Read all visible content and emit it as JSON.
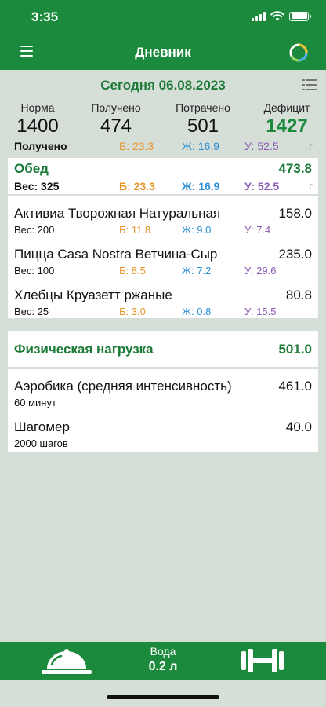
{
  "status": {
    "time": "3:35"
  },
  "nav": {
    "title": "Дневник",
    "menu_icon": "menu-icon",
    "stats_icon": "progress-ring-icon"
  },
  "summary": {
    "date": "Сегодня 06.08.2023",
    "columns": [
      {
        "label": "Норма",
        "value": "1400"
      },
      {
        "label": "Получено",
        "value": "474"
      },
      {
        "label": "Потрачено",
        "value": "501"
      },
      {
        "label": "Дефицит",
        "value": "1427"
      }
    ],
    "received_label": "Получено",
    "macros": {
      "b": "Б: 23.3",
      "j": "Ж: 16.9",
      "u": "У: 52.5",
      "unit": "г"
    }
  },
  "meal": {
    "title": "Обед",
    "total": "473.8",
    "weight": "Вес: 325",
    "b": "Б: 23.3",
    "j": "Ж: 16.9",
    "u": "У: 52.5",
    "unit": "г",
    "items": [
      {
        "name": "Активиа Творожная Натуральная",
        "kcal": "158.0",
        "weight": "Вес: 200",
        "b": "Б: 11.8",
        "j": "Ж: 9.0",
        "u": "У: 7.4"
      },
      {
        "name": "Пицца Casa Nostra Ветчина-Сыр",
        "kcal": "235.0",
        "weight": "Вес: 100",
        "b": "Б: 8.5",
        "j": "Ж: 7.2",
        "u": "У: 29.6"
      },
      {
        "name": "Хлебцы Круазетт ржаные",
        "kcal": "80.8",
        "weight": "Вес: 25",
        "b": "Б: 3.0",
        "j": "Ж: 0.8",
        "u": "У: 15.5"
      }
    ]
  },
  "activity": {
    "title": "Физическая нагрузка",
    "total": "501.0",
    "items": [
      {
        "name": "Аэробика (средняя интенсивность)",
        "kcal": "461.0",
        "sub": "60 минут"
      },
      {
        "name": "Шагомер",
        "kcal": "40.0",
        "sub": "2000 шагов"
      }
    ]
  },
  "bottom": {
    "water_label": "Вода",
    "water_value": "0.2 л",
    "left_icon": "food-cloche-icon",
    "right_icon": "dumbbell-icon"
  },
  "colors": {
    "accent": "#1c8a3c",
    "protein": "#e9952a",
    "fat": "#2b8fd6",
    "carbs": "#8b5bb5"
  }
}
